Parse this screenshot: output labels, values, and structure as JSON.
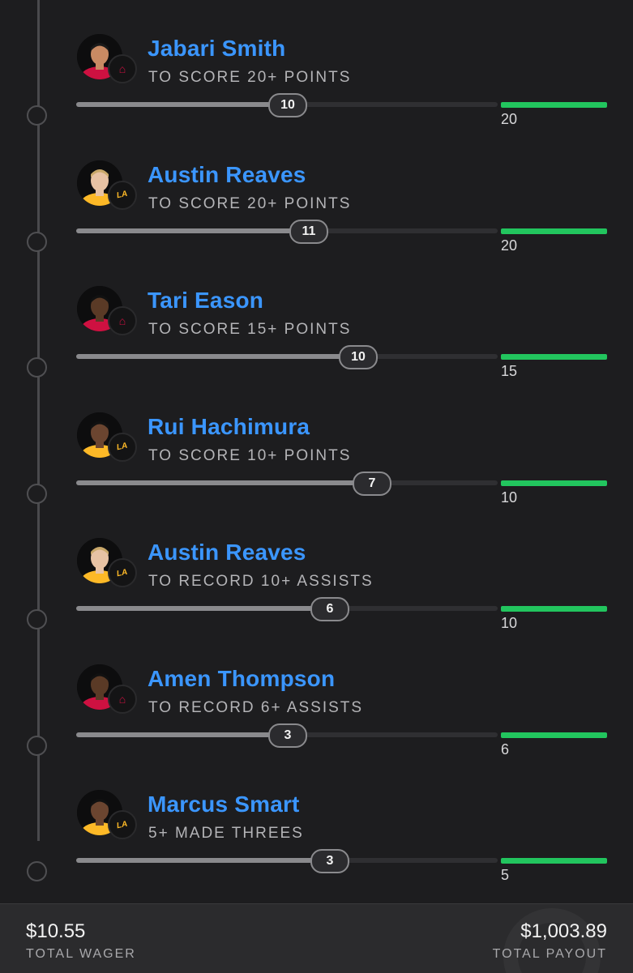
{
  "legs": [
    {
      "player": "Jabari Smith",
      "team_icon": "rockets-logo-icon",
      "prop": "TO SCORE 20+ POINTS",
      "current": "10",
      "target": "20",
      "progress": 0.5
    },
    {
      "player": "Austin Reaves",
      "team_icon": "lakers-logo-icon",
      "prop": "TO SCORE 20+ POINTS",
      "current": "11",
      "target": "20",
      "progress": 0.55
    },
    {
      "player": "Tari Eason",
      "team_icon": "rockets-logo-icon",
      "prop": "TO SCORE 15+ POINTS",
      "current": "10",
      "target": "15",
      "progress": 0.667
    },
    {
      "player": "Rui Hachimura",
      "team_icon": "lakers-logo-icon",
      "prop": "TO SCORE 10+ POINTS",
      "current": "7",
      "target": "10",
      "progress": 0.7
    },
    {
      "player": "Austin Reaves",
      "team_icon": "lakers-logo-icon",
      "prop": "TO RECORD 10+ ASSISTS",
      "current": "6",
      "target": "10",
      "progress": 0.6
    },
    {
      "player": "Amen Thompson",
      "team_icon": "rockets-logo-icon",
      "prop": "TO RECORD 6+ ASSISTS",
      "current": "3",
      "target": "6",
      "progress": 0.5
    },
    {
      "player": "Marcus Smart",
      "team_icon": "lakers-logo-icon",
      "prop": "5+ MADE THREES",
      "current": "3",
      "target": "5",
      "progress": 0.6
    }
  ],
  "footer": {
    "wager_amount": "$10.55",
    "wager_label": "TOTAL WAGER",
    "payout_amount": "$1,003.89",
    "payout_label": "TOTAL PAYOUT"
  },
  "colors": {
    "accent_blue": "#3b96ff",
    "target_green": "#22c55e",
    "rockets_red": "#ce1141",
    "lakers_gold": "#fdb927",
    "lakers_purple": "#552583"
  }
}
